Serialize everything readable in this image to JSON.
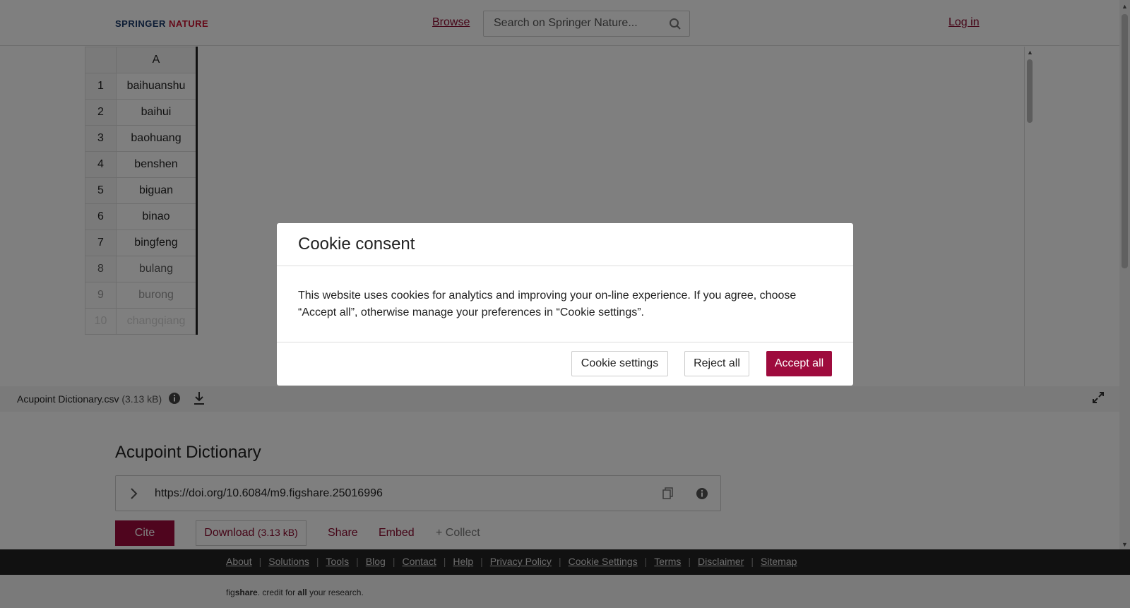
{
  "header": {
    "logo_left": "SPRINGER",
    "logo_right": "NATURE",
    "browse": "Browse",
    "search_placeholder": "Search on Springer Nature...",
    "login": "Log in"
  },
  "sheet": {
    "column": "A",
    "rows": [
      {
        "n": "1",
        "v": "baihuanshu"
      },
      {
        "n": "2",
        "v": "baihui"
      },
      {
        "n": "3",
        "v": "baohuang"
      },
      {
        "n": "4",
        "v": "benshen"
      },
      {
        "n": "5",
        "v": "biguan"
      },
      {
        "n": "6",
        "v": "binao"
      },
      {
        "n": "7",
        "v": "bingfeng"
      },
      {
        "n": "8",
        "v": "bulang"
      },
      {
        "n": "9",
        "v": "burong"
      },
      {
        "n": "10",
        "v": "changqiang"
      }
    ]
  },
  "file_bar": {
    "name": "Acupoint Dictionary.csv",
    "size": "(3.13 kB)"
  },
  "item": {
    "title": "Acupoint Dictionary",
    "doi": "https://doi.org/10.6084/m9.figshare.25016996",
    "cite": "Cite",
    "download": "Download",
    "download_size": "(3.13 kB)",
    "share": "Share",
    "embed": "Embed",
    "collect": "+ Collect"
  },
  "footer": {
    "links": [
      "About",
      "Solutions",
      "Tools",
      "Blog",
      "Contact",
      "Help",
      "Privacy Policy",
      "Cookie Settings",
      "Terms",
      "Disclaimer",
      "Sitemap"
    ],
    "tagline_1": "fig",
    "tagline_2": "share",
    "tagline_3": ". credit for ",
    "tagline_4": "all",
    "tagline_5": " your research."
  },
  "cookie": {
    "title": "Cookie consent",
    "body": "This website uses cookies for analytics and improving your on-line experience. If you agree, choose “Accept all”, otherwise manage your preferences in “Cookie settings”.",
    "settings": "Cookie settings",
    "reject": "Reject all",
    "accept": "Accept all"
  },
  "colors": {
    "brand": "#9e0b3d",
    "link": "#8b0a2e"
  }
}
